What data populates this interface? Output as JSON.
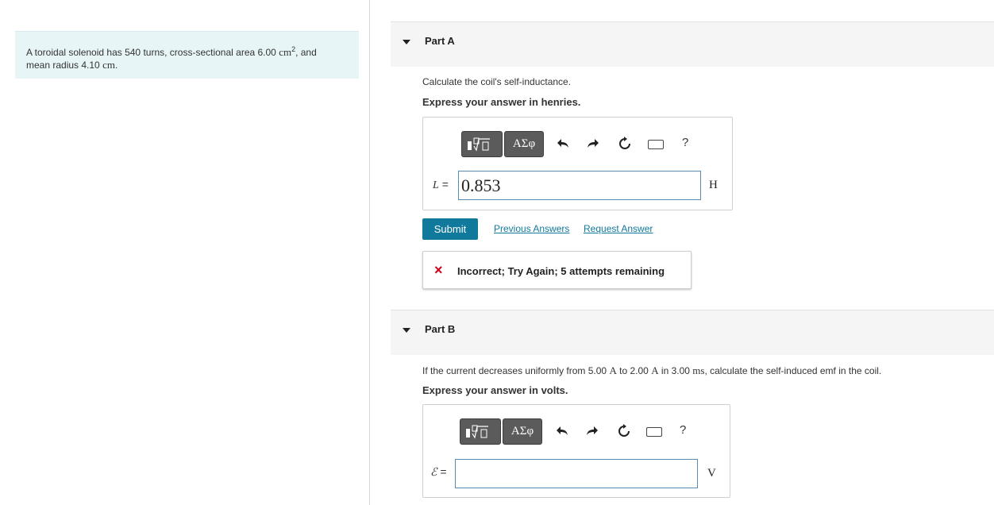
{
  "problem": {
    "text_a": "A toroidal solenoid has 540 turns, cross-sectional area 6.00 ",
    "area_unit": "cm",
    "area_exp": "2",
    "text_b": ", and",
    "text_c": "mean radius 4.10 ",
    "radius_unit": "cm",
    "text_d": "."
  },
  "part_a": {
    "title": "Part A",
    "prompt": "Calculate the coil's self-inductance.",
    "instruction": "Express your answer in henries.",
    "toolbar": {
      "template_icon": "fraction-sqrt-template-icon",
      "greek_label": "ΑΣφ",
      "undo_icon": "undo-icon",
      "redo_icon": "redo-icon",
      "reset_icon": "reset-icon",
      "keyboard_icon": "keyboard-icon",
      "help_label": "?"
    },
    "variable": "L",
    "equals": "=",
    "answer_value": "0.853",
    "unit": "H",
    "submit_label": "Submit",
    "previous_answers_label": "Previous Answers",
    "request_answer_label": "Request Answer",
    "feedback": "Incorrect; Try Again; 5 attempts remaining",
    "feedback_icon": "×"
  },
  "part_b": {
    "title": "Part B",
    "prompt_a": "If the current decreases uniformly from 5.00 ",
    "u1": "A",
    "prompt_b": " to 2.00 ",
    "u2": "A",
    "prompt_c": " in 3.00 ",
    "u3": "ms",
    "prompt_d": ", calculate the self-induced emf in the coil.",
    "instruction": "Express your answer in volts.",
    "toolbar": {
      "greek_label": "ΑΣφ",
      "help_label": "?"
    },
    "variable": "ℰ",
    "equals": "=",
    "answer_value": "",
    "unit": "V"
  },
  "colors": {
    "accent": "#10799c",
    "error": "#d0021b",
    "problem_bg": "#e8f5f7"
  }
}
